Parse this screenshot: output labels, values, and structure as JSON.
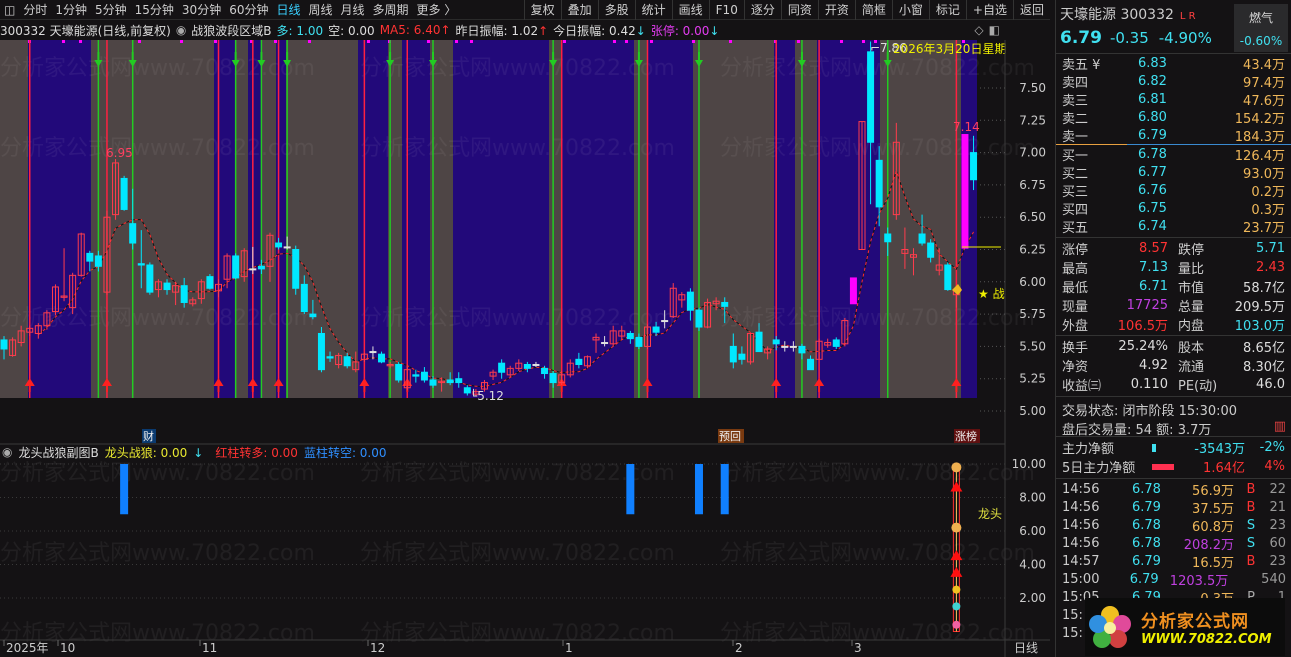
{
  "toolbar": {
    "periods": [
      "分时",
      "1分钟",
      "5分钟",
      "15分钟",
      "30分钟",
      "60分钟",
      "日线",
      "周线",
      "月线",
      "多周期",
      "更多 〉"
    ],
    "active_period": "日线",
    "buttons": [
      "复权",
      "叠加",
      "多股",
      "统计",
      "画线",
      "F10",
      "逐分",
      "同资",
      "开资",
      "简框",
      "小窗",
      "标记",
      "+自选",
      "返回"
    ]
  },
  "infoline": {
    "stock": "300332 天壕能源(日线,前复权)",
    "indicator": "战狼波段区域B",
    "duo": "多: 1.00",
    "kong": "空: 0.00",
    "ma5": "MA5: 6.40",
    "ma5_arrow": "↑",
    "zuori": "昨日振幅: 1.02",
    "zuori_arrow": "↑",
    "jinri": "今日振幅: 0.42",
    "jinri_arrow": "↓",
    "zhangting": "张停: 0.00",
    "zhangting_arrow": "↓"
  },
  "chart_data": {
    "type": "candlestick",
    "price_axis": {
      "ticks": [
        "7.50",
        "7.25",
        "7.00",
        "6.75",
        "6.50",
        "6.25",
        "6.00",
        "5.75",
        "5.50",
        "5.25",
        "5.00"
      ],
      "range": [
        5.0,
        7.9
      ]
    },
    "candles": [
      [
        5.55,
        5.58,
        5.4,
        5.48
      ],
      [
        5.43,
        5.57,
        5.42,
        5.55
      ],
      [
        5.53,
        5.66,
        5.5,
        5.62
      ],
      [
        5.61,
        5.66,
        5.58,
        5.64
      ],
      [
        5.6,
        5.68,
        5.56,
        5.66
      ],
      [
        5.66,
        5.78,
        5.63,
        5.76
      ],
      [
        5.77,
        5.98,
        5.74,
        5.96
      ],
      [
        5.88,
        6.26,
        5.85,
        5.89
      ],
      [
        5.8,
        6.07,
        5.75,
        6.05
      ],
      [
        6.05,
        6.38,
        6.04,
        6.37
      ],
      [
        6.22,
        6.24,
        6.08,
        6.16
      ],
      [
        6.2,
        6.24,
        6.08,
        6.12
      ],
      [
        5.92,
        6.55,
        5.9,
        6.5
      ],
      [
        6.52,
        6.95,
        6.48,
        6.92
      ],
      [
        6.8,
        6.82,
        6.55,
        6.56
      ],
      [
        6.45,
        6.72,
        6.25,
        6.3
      ],
      [
        6.14,
        6.4,
        5.95,
        6.13
      ],
      [
        6.13,
        6.15,
        5.9,
        5.92
      ],
      [
        5.94,
        6.02,
        5.88,
        6.0
      ],
      [
        5.99,
        6.02,
        5.9,
        5.94
      ],
      [
        5.92,
        6.0,
        5.82,
        5.97
      ],
      [
        5.97,
        6.03,
        5.8,
        5.84
      ],
      [
        5.83,
        5.88,
        5.81,
        5.86
      ],
      [
        5.87,
        6.02,
        5.83,
        6.0
      ],
      [
        6.04,
        6.06,
        5.94,
        5.95
      ],
      [
        5.93,
        6.02,
        5.88,
        5.98
      ],
      [
        6.02,
        6.22,
        5.95,
        6.2
      ],
      [
        6.2,
        6.22,
        6.02,
        6.03
      ],
      [
        6.04,
        6.26,
        6.0,
        6.24
      ],
      [
        6.1,
        6.27,
        6.06,
        6.1
      ],
      [
        6.12,
        6.17,
        6.06,
        6.1
      ],
      [
        6.12,
        6.38,
        6.0,
        6.36
      ],
      [
        6.3,
        6.34,
        6.25,
        6.27
      ],
      [
        6.27,
        6.35,
        6.25,
        6.27
      ],
      [
        6.25,
        6.28,
        5.9,
        5.95
      ],
      [
        5.98,
        6.05,
        5.75,
        5.77
      ],
      [
        5.75,
        5.86,
        5.71,
        5.73
      ],
      [
        5.6,
        5.65,
        5.3,
        5.32
      ],
      [
        5.42,
        5.46,
        5.38,
        5.41
      ],
      [
        5.36,
        5.45,
        5.33,
        5.43
      ],
      [
        5.42,
        5.45,
        5.33,
        5.35
      ],
      [
        5.32,
        5.46,
        5.3,
        5.38
      ],
      [
        5.4,
        5.45,
        5.38,
        5.44
      ],
      [
        5.46,
        5.5,
        5.4,
        5.46
      ],
      [
        5.44,
        5.46,
        5.37,
        5.38
      ],
      [
        5.35,
        5.38,
        5.33,
        5.36
      ],
      [
        5.36,
        5.38,
        5.22,
        5.24
      ],
      [
        5.18,
        5.36,
        5.16,
        5.32
      ],
      [
        5.28,
        5.32,
        5.22,
        5.27
      ],
      [
        5.3,
        5.34,
        5.22,
        5.24
      ],
      [
        5.24,
        5.27,
        5.18,
        5.2
      ],
      [
        5.22,
        5.26,
        5.15,
        5.23
      ],
      [
        5.24,
        5.3,
        5.2,
        5.22
      ],
      [
        5.25,
        5.3,
        5.18,
        5.22
      ],
      [
        5.18,
        5.2,
        5.12,
        5.14
      ],
      [
        5.13,
        5.17,
        5.12,
        5.15
      ],
      [
        5.17,
        5.24,
        5.15,
        5.22
      ],
      [
        5.27,
        5.32,
        5.24,
        5.3
      ],
      [
        5.37,
        5.4,
        5.25,
        5.3
      ],
      [
        5.28,
        5.35,
        5.26,
        5.33
      ],
      [
        5.33,
        5.4,
        5.31,
        5.37
      ],
      [
        5.36,
        5.38,
        5.3,
        5.33
      ],
      [
        5.36,
        5.38,
        5.34,
        5.36
      ],
      [
        5.33,
        5.35,
        5.25,
        5.29
      ],
      [
        5.29,
        5.31,
        5.18,
        5.22
      ],
      [
        5.22,
        5.31,
        5.2,
        5.28
      ],
      [
        5.28,
        5.4,
        5.26,
        5.37
      ],
      [
        5.4,
        5.45,
        5.33,
        5.36
      ],
      [
        5.35,
        5.43,
        5.33,
        5.42
      ],
      [
        5.55,
        5.6,
        5.45,
        5.57
      ],
      [
        5.53,
        5.58,
        5.5,
        5.53
      ],
      [
        5.52,
        5.66,
        5.5,
        5.62
      ],
      [
        5.58,
        5.66,
        5.55,
        5.62
      ],
      [
        5.6,
        5.62,
        5.52,
        5.56
      ],
      [
        5.57,
        5.6,
        5.48,
        5.5
      ],
      [
        5.5,
        5.67,
        5.48,
        5.65
      ],
      [
        5.65,
        5.69,
        5.58,
        5.61
      ],
      [
        5.7,
        5.78,
        5.64,
        5.7
      ],
      [
        5.73,
        5.99,
        5.72,
        5.95
      ],
      [
        5.86,
        5.92,
        5.8,
        5.9
      ],
      [
        5.92,
        5.95,
        5.7,
        5.78
      ],
      [
        5.78,
        5.8,
        5.62,
        5.65
      ],
      [
        5.65,
        5.87,
        5.64,
        5.84
      ],
      [
        5.83,
        5.88,
        5.78,
        5.85
      ],
      [
        5.84,
        5.88,
        5.68,
        5.81
      ],
      [
        5.5,
        5.6,
        5.33,
        5.38
      ],
      [
        5.44,
        5.5,
        5.36,
        5.4
      ],
      [
        5.38,
        5.6,
        5.36,
        5.6
      ],
      [
        5.61,
        5.68,
        5.46,
        5.46
      ],
      [
        5.45,
        5.5,
        5.4,
        5.48
      ],
      [
        5.55,
        5.58,
        5.47,
        5.52
      ],
      [
        5.5,
        5.54,
        5.46,
        5.5
      ],
      [
        5.5,
        5.54,
        5.46,
        5.5
      ],
      [
        5.5,
        5.52,
        5.4,
        5.45
      ],
      [
        5.4,
        5.43,
        5.32,
        5.32
      ],
      [
        5.4,
        5.56,
        5.4,
        5.54
      ],
      [
        5.51,
        5.56,
        5.49,
        5.53
      ],
      [
        5.55,
        5.57,
        5.48,
        5.5
      ],
      [
        5.52,
        5.72,
        5.5,
        5.7
      ],
      [
        5.83,
        6.09,
        5.78,
        6.03
      ],
      [
        6.25,
        7.24,
        6.25,
        7.24
      ],
      [
        7.78,
        7.86,
        6.6,
        7.08
      ],
      [
        6.94,
        7.05,
        6.43,
        6.58
      ],
      [
        6.37,
        6.42,
        6.2,
        6.31
      ],
      [
        6.52,
        7.23,
        6.48,
        7.08
      ],
      [
        6.22,
        6.42,
        6.1,
        6.25
      ],
      [
        6.19,
        6.26,
        6.05,
        6.21
      ],
      [
        6.37,
        6.52,
        6.28,
        6.3
      ],
      [
        6.3,
        6.33,
        6.15,
        6.19
      ],
      [
        6.09,
        6.26,
        6.05,
        6.13
      ],
      [
        6.13,
        6.15,
        5.93,
        5.94
      ],
      [
        5.9,
        5.95,
        5.8,
        5.93
      ],
      [
        6.26,
        7.14,
        6.26,
        7.14
      ],
      [
        7.0,
        7.13,
        6.71,
        6.79
      ]
    ],
    "magenta_candles": [
      99,
      112
    ],
    "bands": [
      [
        "gray",
        0,
        28
      ],
      [
        "blue",
        28,
        91
      ],
      [
        "gray",
        91,
        214
      ],
      [
        "blue",
        214,
        235
      ],
      [
        "gray",
        235,
        248
      ],
      [
        "blue",
        248,
        261
      ],
      [
        "gray",
        261,
        276
      ],
      [
        "blue",
        276,
        286
      ],
      [
        "gray",
        286,
        358
      ],
      [
        "blue",
        358,
        388
      ],
      [
        "gray",
        388,
        402
      ],
      [
        "blue",
        402,
        430
      ],
      [
        "gray",
        430,
        453
      ],
      [
        "blue",
        453,
        549
      ],
      [
        "gray",
        549,
        562
      ],
      [
        "blue",
        562,
        634
      ],
      [
        "gray",
        634,
        647
      ],
      [
        "blue",
        647,
        693
      ],
      [
        "gray",
        693,
        774
      ],
      [
        "blue",
        774,
        795
      ],
      [
        "gray",
        795,
        817
      ],
      [
        "blue",
        817,
        880
      ],
      [
        "gray",
        880,
        961
      ],
      [
        "blue",
        961,
        977
      ]
    ],
    "green_signal_bars": [
      11,
      15,
      27,
      30,
      33,
      45,
      50,
      64,
      74,
      81,
      93,
      103
    ],
    "red_signal_bars": [
      3,
      12,
      25,
      29,
      32,
      42,
      47,
      65,
      75,
      90,
      95,
      111
    ],
    "annotations": {
      "high_left": "6.95",
      "high_right": "7.14",
      "high_top": "7.86",
      "low": "5.12",
      "date": "2026年3月20日星期",
      "star": "★ 战"
    },
    "time_axis": [
      "2025年",
      "10",
      "11",
      "12",
      "1",
      "2",
      "3"
    ],
    "period_label": "日线",
    "markers": {
      "cai": "财",
      "yuhui": "预回",
      "zhangbang": "涨榜"
    },
    "sub": {
      "title": "龙头战狼副图B",
      "longtou": "龙头战狼: 0.00",
      "longtou_arrow": "↓",
      "hong": "红柱转多: 0.00",
      "lan": "蓝柱转空: 0.00",
      "ticks": [
        "10.00",
        "8.00",
        "6.00",
        "4.00",
        "2.00"
      ],
      "range": [
        0,
        11
      ],
      "blue_bars": [
        {
          "bar": 14,
          "from": 7,
          "to": 10
        },
        {
          "bar": 73,
          "from": 7,
          "to": 10
        },
        {
          "bar": 81,
          "from": 7,
          "to": 10
        },
        {
          "bar": 84,
          "from": 7,
          "to": 10
        }
      ],
      "signal_column": {
        "bar": 111,
        "from": 0,
        "to": 10
      },
      "label": "龙头"
    },
    "watermark": "分析家公式网www.70822.com"
  },
  "right_panel": {
    "name": "天壕能源",
    "code": "300332",
    "lr": "L R",
    "price": "6.79",
    "change": "-0.35",
    "pct": "-4.90%",
    "sector": "燃气",
    "sector_pct": "-0.60%",
    "asks": [
      {
        "l": "卖五 ¥",
        "p": "6.83",
        "v": "43.4万"
      },
      {
        "l": "卖四",
        "p": "6.82",
        "v": "97.4万"
      },
      {
        "l": "卖三",
        "p": "6.81",
        "v": "47.6万"
      },
      {
        "l": "卖二",
        "p": "6.80",
        "v": "154.2万"
      },
      {
        "l": "卖一",
        "p": "6.79",
        "v": "184.3万"
      }
    ],
    "bids": [
      {
        "l": "买一",
        "p": "6.78",
        "v": "126.4万"
      },
      {
        "l": "买二",
        "p": "6.77",
        "v": "93.0万"
      },
      {
        "l": "买三",
        "p": "6.76",
        "v": "0.2万"
      },
      {
        "l": "买四",
        "p": "6.75",
        "v": "0.3万"
      },
      {
        "l": "买五",
        "p": "6.74",
        "v": "23.7万"
      }
    ],
    "stats1": [
      {
        "k": "涨停",
        "v": "8.57",
        "vc": "c-red",
        "k2": "跌停",
        "v2": "5.71",
        "v2c": "c-cyan"
      },
      {
        "k": "最高",
        "v": "7.13",
        "vc": "c-cyan",
        "k2": "量比",
        "v2": "2.43",
        "v2c": "c-red"
      },
      {
        "k": "最低",
        "v": "6.71",
        "vc": "c-cyan",
        "k2": "市值",
        "v2": "58.7亿",
        "v2c": "c-wh"
      },
      {
        "k": "现量",
        "v": "17725",
        "vc": "c-purple",
        "k2": "总量",
        "v2": "209.5万",
        "v2c": "c-wh"
      },
      {
        "k": "外盘",
        "v": "106.5万",
        "vc": "c-red",
        "k2": "内盘",
        "v2": "103.0万",
        "v2c": "c-cyan"
      }
    ],
    "stats2": [
      {
        "k": "换手",
        "v": "25.24%",
        "vc": "c-wh",
        "k2": "股本",
        "v2": "8.65亿",
        "v2c": "c-wh"
      },
      {
        "k": "净资",
        "v": "4.92",
        "vc": "c-wh",
        "k2": "流通",
        "v2": "8.30亿",
        "v2c": "c-wh"
      },
      {
        "k": "收益㈢",
        "v": "0.110",
        "vc": "c-wh",
        "k2": "PE(动)",
        "v2": "46.0",
        "v2c": "c-wh"
      }
    ],
    "trade_status": "交易状态: 闭市阶段 15:30:00",
    "after_hours": "盘后交易量: 54  额: 3.7万",
    "flow": [
      {
        "k": "主力净额",
        "v": "-3543万",
        "pct": "-2%",
        "c": "c-cyan"
      },
      {
        "k": "5日主力净额",
        "v": "1.64亿",
        "pct": "4%",
        "c": "c-red"
      }
    ],
    "trades": [
      {
        "t": "14:56",
        "p": "6.78",
        "v": "56.9万",
        "vc": "c-org",
        "bs": "B",
        "n": "22"
      },
      {
        "t": "14:56",
        "p": "6.79",
        "v": "37.5万",
        "vc": "c-org",
        "bs": "B",
        "n": "21"
      },
      {
        "t": "14:56",
        "p": "6.78",
        "v": "60.8万",
        "vc": "c-org",
        "bs": "S",
        "n": "23"
      },
      {
        "t": "14:56",
        "p": "6.78",
        "v": "208.2万",
        "vc": "c-purple",
        "bs": "S",
        "n": "60"
      },
      {
        "t": "14:57",
        "p": "6.79",
        "v": "16.5万",
        "vc": "c-org",
        "bs": "B",
        "n": "23"
      },
      {
        "t": "15:00",
        "p": "6.79",
        "v": "1203.5万",
        "vc": "c-purple",
        "bs": "",
        "n": "540"
      },
      {
        "t": "15:05",
        "p": "6.79",
        "v": "0.3万",
        "vc": "c-org",
        "bs": "P",
        "n": "1"
      },
      {
        "t": "15:",
        "p": "",
        "v": "",
        "vc": "c-org",
        "bs": "",
        "n": ""
      },
      {
        "t": "15:",
        "p": "",
        "v": "",
        "vc": "c-org",
        "bs": "",
        "n": ""
      }
    ],
    "logo": {
      "name": "分析家公式网",
      "url": "WWW.70822.COM"
    }
  },
  "colors": {
    "up": "#ff3c4c",
    "down": "#00e8ff",
    "band_blue": "#22097a",
    "band_gray": "#4e4545",
    "magenta": "#ff00ff",
    "green": "#22cc22",
    "ma": "#ff3030",
    "accent": "#3ad0ff"
  }
}
